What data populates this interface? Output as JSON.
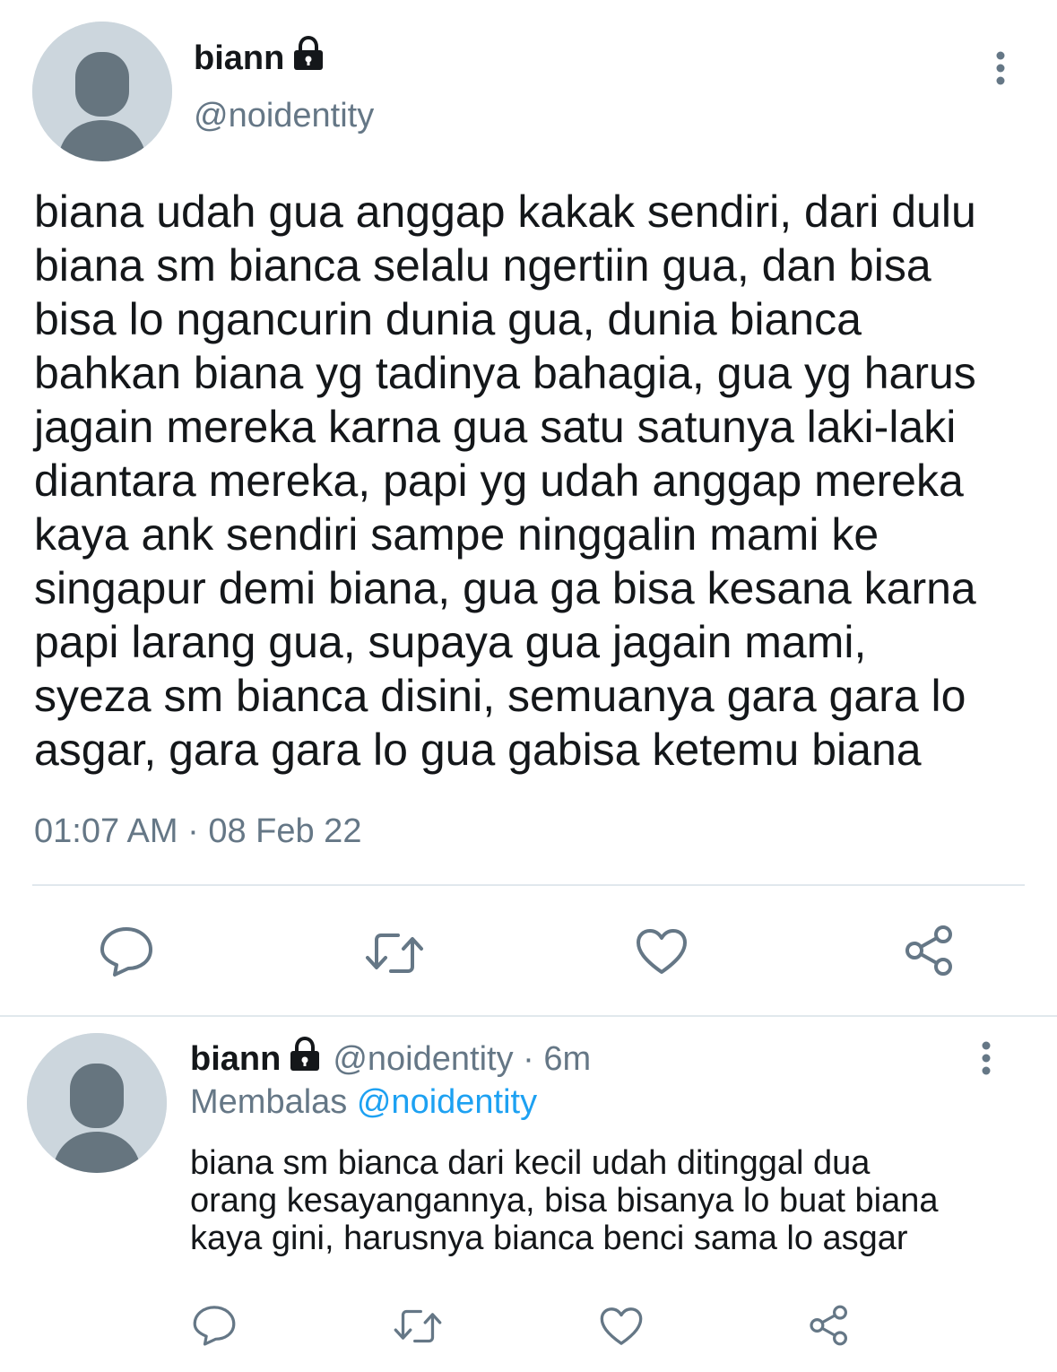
{
  "main_tweet": {
    "display_name": "biann",
    "protected_icon": "lock-icon",
    "handle": "@noidentity",
    "body": "biana udah gua anggap kakak sendiri, dari dulu\nbiana sm bianca selalu ngertiin gua, dan bisa\nbisa lo ngancurin dunia gua, dunia bianca\nbahkan biana yg tadinya bahagia, gua yg harus\njagain mereka karna gua satu satunya laki-laki\ndiantara mereka, papi yg udah anggap mereka\nkaya ank sendiri sampe ninggalin mami ke\nsingapur demi biana, gua ga bisa kesana karna\npapi larang gua, supaya gua jagain mami,\nsyeza sm bianca disini, semuanya gara gara lo\nasgar, gara gara lo gua gabisa ketemu biana",
    "timestamp": "01:07 AM · 08 Feb 22",
    "actions": [
      "reply-icon",
      "retweet-icon",
      "like-icon",
      "share-icon"
    ]
  },
  "reply_tweet": {
    "display_name": "biann",
    "protected_icon": "lock-icon",
    "handle_time": "@noidentity · 6m",
    "replying_prefix": "Membalas",
    "replying_to": "@noidentity",
    "body": "biana sm bianca dari kecil udah ditinggal dua\norang kesayangannya, bisa bisanya lo buat biana\nkaya gini, harusnya bianca benci sama lo asgar",
    "actions": [
      "reply-icon",
      "retweet-icon",
      "like-icon",
      "share-icon"
    ]
  },
  "colors": {
    "text": "#14171a",
    "secondary": "#657786",
    "link": "#1da1f2",
    "divider": "#e1e8ed",
    "avatar_bg": "#ccd6dd",
    "avatar_fg": "#66757f"
  }
}
